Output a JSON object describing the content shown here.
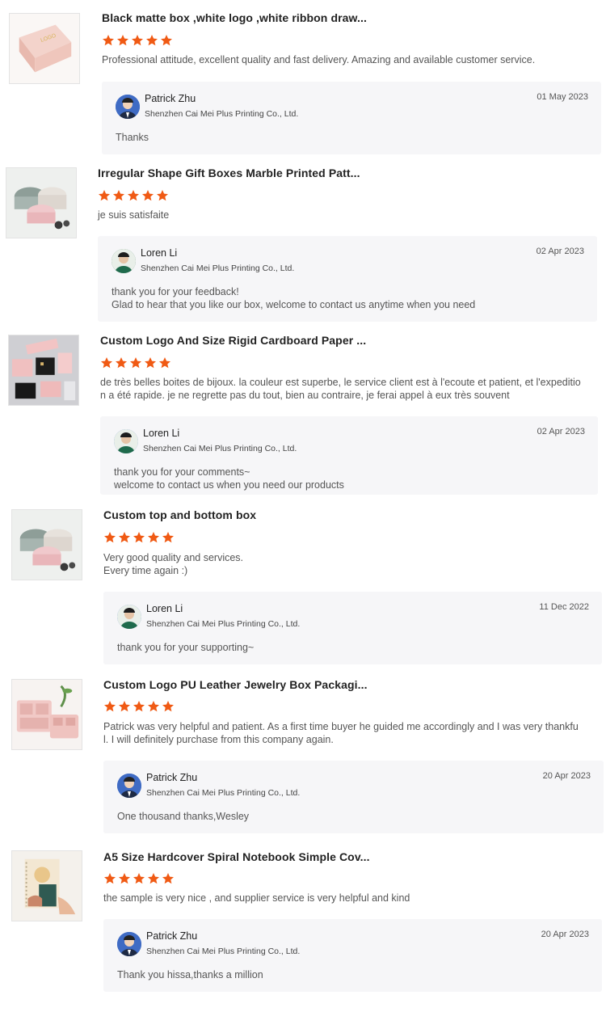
{
  "reviews": [
    {
      "title": "Black matte box ,white logo ,white ribbon draw...",
      "thumb_icon": "pink-drawer-box-image",
      "rating": 5,
      "comment": "Professional attitude, excellent quality and fast delivery. Amazing and available customer service.",
      "reply": {
        "name": "Patrick Zhu",
        "company": "Shenzhen Cai Mei Plus Printing Co., Ltd.",
        "date": "01 May 2023",
        "text": "Thanks"
      }
    },
    {
      "title": "Irregular Shape Gift Boxes Marble Printed Patt...",
      "thumb_icon": "marble-gift-boxes-image",
      "rating": 5,
      "comment": "je suis satisfaite",
      "reply": {
        "name": "Loren Li",
        "company": "Shenzhen Cai Mei Plus Printing Co., Ltd.",
        "date": "02 Apr 2023",
        "text": "thank you for your feedback!\nGlad to hear that you like our box, welcome to contact us anytime when you need"
      }
    },
    {
      "title": "Custom Logo And Size Rigid Cardboard Paper ...",
      "thumb_icon": "jewelry-boxes-image",
      "rating": 5,
      "comment": "de très belles boites de bijoux. la couleur est superbe, le service client est à l'ecoute et patient, et l'expeditio\nn a été rapide. je ne regrette pas du tout, bien au contraire, je ferai appel à eux très souvent",
      "reply": {
        "name": "Loren Li",
        "company": "Shenzhen Cai Mei Plus Printing Co., Ltd.",
        "date": "02 Apr 2023",
        "text": "thank you for your comments~\nwelcome to contact us when you need our products"
      }
    },
    {
      "title": "Custom top and bottom box",
      "thumb_icon": "marble-gift-boxes-image",
      "rating": 5,
      "comment": "Very good quality and services.\nEvery time again :)",
      "reply": {
        "name": "Loren Li",
        "company": "Shenzhen Cai Mei Plus Printing Co., Ltd.",
        "date": "11 Dec 2022",
        "text": "thank you for your supporting~"
      }
    },
    {
      "title": "Custom Logo PU Leather Jewelry Box Packagi...",
      "thumb_icon": "leather-jewelry-box-image",
      "rating": 5,
      "comment": "Patrick was very helpful and patient. As a first time buyer he guided me accordingly and I was very thankfu\nl. I will definitely purchase from this company again.",
      "reply": {
        "name": "Patrick Zhu",
        "company": "Shenzhen Cai Mei Plus Printing Co., Ltd.",
        "date": "20 Apr 2023",
        "text": "One thousand thanks,Wesley"
      }
    },
    {
      "title": "A5 Size Hardcover Spiral Notebook Simple Cov...",
      "thumb_icon": "spiral-notebook-image",
      "rating": 5,
      "comment": "the sample is very nice , and supplier service is very helpful and kind",
      "reply": {
        "name": "Patrick Zhu",
        "company": "Shenzhen Cai Mei Plus Printing Co., Ltd.",
        "date": "20 Apr 2023",
        "text": "Thank you hissa,thanks a million"
      }
    }
  ],
  "colors": {
    "star": "#f05a14",
    "reply_bg": "#f6f6f8",
    "title": "#222222",
    "comment": "#555555"
  }
}
